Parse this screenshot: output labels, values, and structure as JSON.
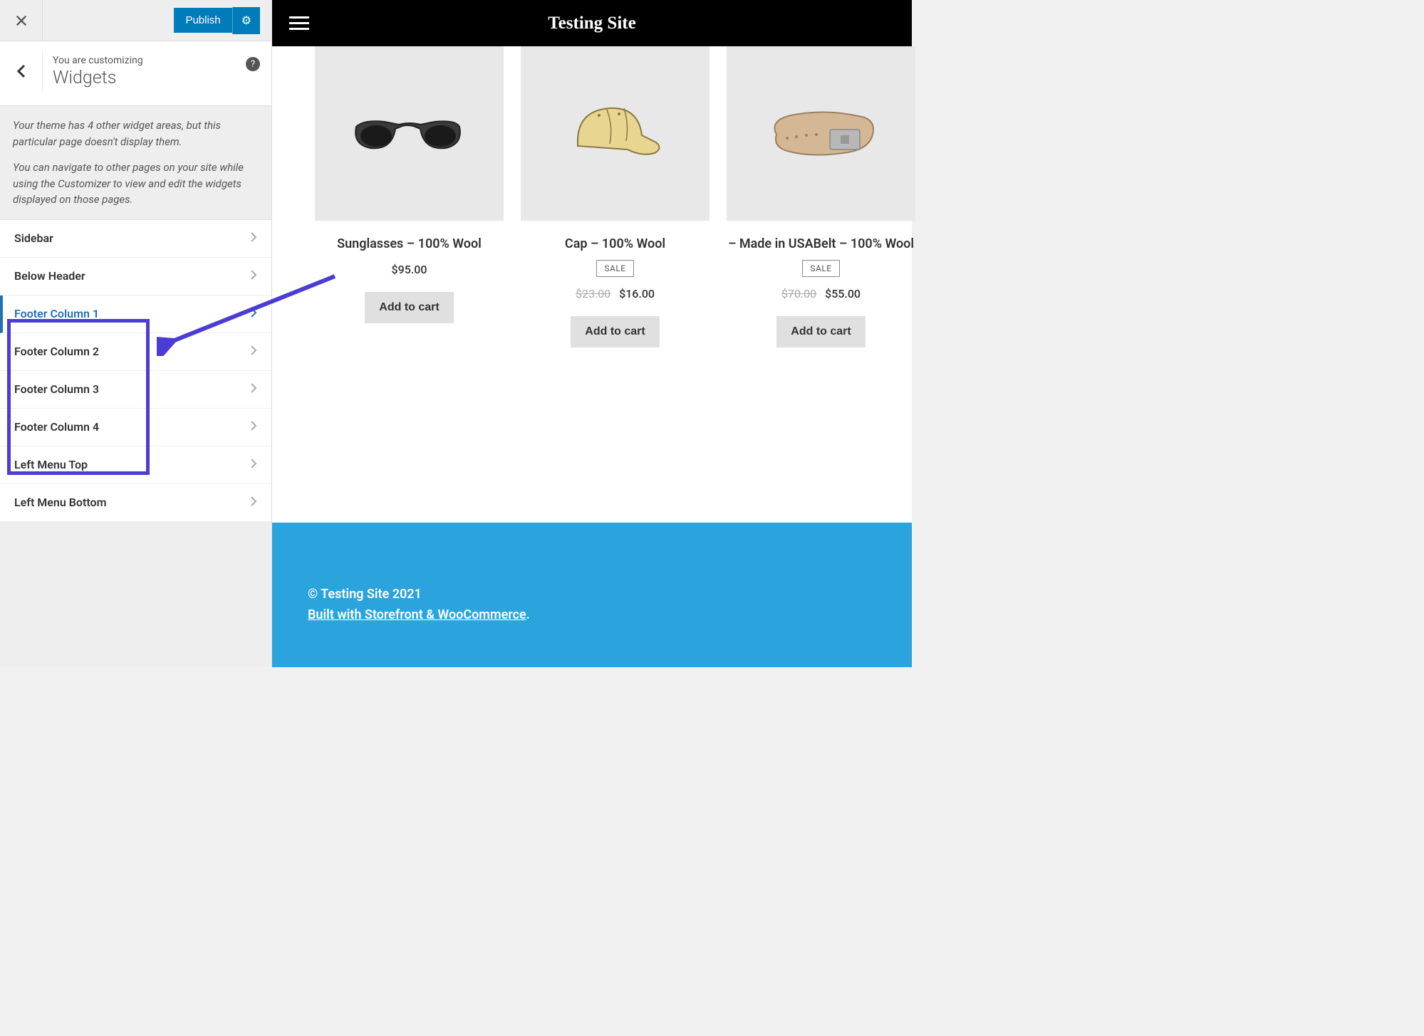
{
  "customizer": {
    "publish_label": "Publish",
    "subtitle": "You are customizing",
    "title": "Widgets",
    "desc1": "Your theme has 4 other widget areas, but this particular page doesn't display them.",
    "desc2": "You can navigate to other pages on your site while using the Customizer to view and edit the widgets displayed on those pages.",
    "items": [
      {
        "label": "Sidebar"
      },
      {
        "label": "Below Header"
      },
      {
        "label": "Footer Column 1"
      },
      {
        "label": "Footer Column 2"
      },
      {
        "label": "Footer Column 3"
      },
      {
        "label": "Footer Column 4"
      },
      {
        "label": "Left Menu Top"
      },
      {
        "label": "Left Menu Bottom"
      }
    ]
  },
  "site": {
    "title": "Testing Site"
  },
  "products": [
    {
      "name": "Sunglasses – 100% Wool",
      "price": "$95.00",
      "sale": false,
      "old_price": "",
      "cart": "Add to cart"
    },
    {
      "name": "Cap – 100% Wool",
      "price": "$16.00",
      "sale": true,
      "sale_label": "SALE",
      "old_price": "$23.00",
      "cart": "Add to cart"
    },
    {
      "name": "– Made in USABelt – 100% Wool",
      "price": "$55.00",
      "sale": true,
      "sale_label": "SALE",
      "old_price": "$70.00",
      "cart": "Add to cart"
    }
  ],
  "footer": {
    "copyright": "© Testing Site 2021",
    "built": "Built with Storefront & WooCommerce",
    "dot": "."
  }
}
